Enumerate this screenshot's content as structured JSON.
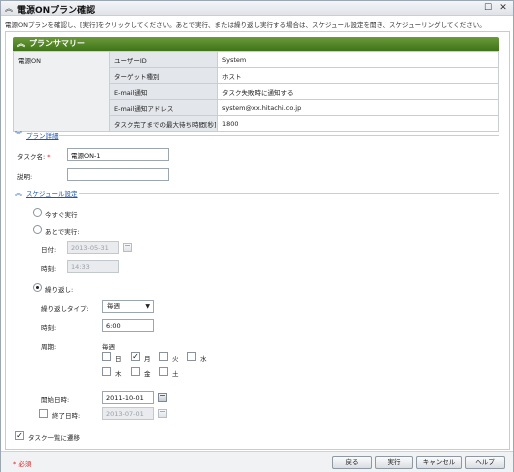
{
  "window": {
    "title": "電源ONプラン確認",
    "instruction": "電源ONプランを確認し、[実行]をクリックしてください。あとで実行、または繰り返し実行する場合は、スケジュール設定を開き、スケジューリングしてください。"
  },
  "summary": {
    "header": "プランサマリー",
    "plan_name": "電源ON",
    "rows": [
      {
        "key": "ユーザーID",
        "value": "System"
      },
      {
        "key": "ターゲット種別",
        "value": "ホスト"
      },
      {
        "key": "E-mail通知",
        "value": "タスク失敗時に通知する"
      },
      {
        "key": "E-mail通知アドレス",
        "value": "system@xx.hitachi.co.jp"
      },
      {
        "key": "タスク完了までの最大待ち時間[秒]",
        "value": "1800"
      }
    ]
  },
  "plan_detail": {
    "section_label": "プラン詳細",
    "task_name_label": "タスク名:",
    "required_mark": "*",
    "task_name_value": "電源ON-1",
    "description_label": "説明:",
    "description_value": ""
  },
  "schedule": {
    "section_label": "スケジュール設定",
    "run_now_label": "今すぐ実行",
    "run_later_label": "あとで実行:",
    "date_label": "日付:",
    "date_value": "2013-05-31",
    "time_label": "時刻:",
    "time_value": "14:33",
    "repeat_label": "繰り返し:",
    "repeat_type_label": "繰り返しタイプ:",
    "repeat_type_value": "毎週",
    "repeat_time_label": "時刻:",
    "repeat_time_value": "6:00",
    "period_label": "周期:",
    "period_value": "毎週",
    "days": [
      {
        "label": "日",
        "checked": false
      },
      {
        "label": "月",
        "checked": true
      },
      {
        "label": "火",
        "checked": false
      },
      {
        "label": "水",
        "checked": false
      },
      {
        "label": "木",
        "checked": false
      },
      {
        "label": "金",
        "checked": false
      },
      {
        "label": "土",
        "checked": false
      }
    ],
    "start_label": "開始日時:",
    "start_value": "2011-10-01",
    "end_label": "終了日時:",
    "end_value": "2013-07-01",
    "goto_tasklist_label": "タスク一覧に遷移",
    "selected_mode": "repeat"
  },
  "footer": {
    "required_note": "* 必須",
    "back": "戻る",
    "execute": "実行",
    "cancel": "キャンセル",
    "help": "ヘルプ"
  }
}
